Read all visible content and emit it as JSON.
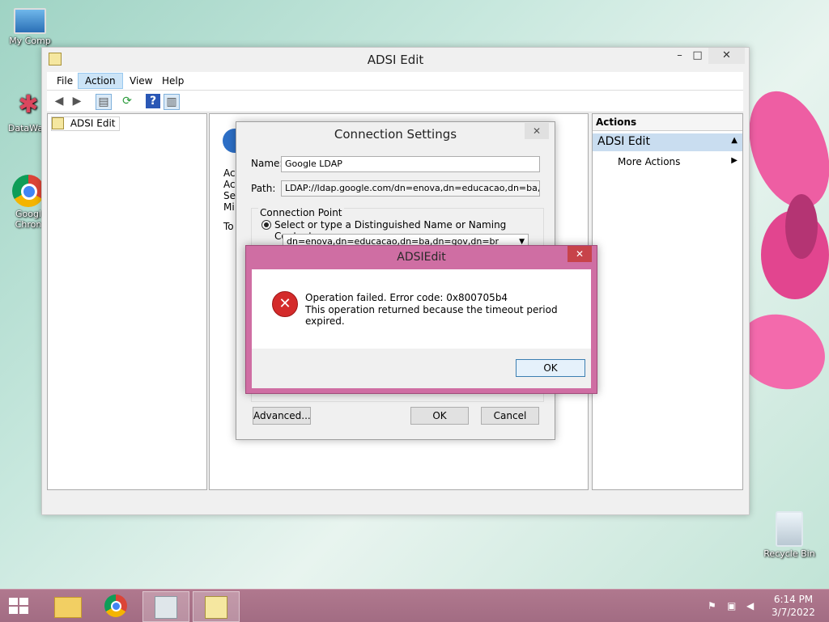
{
  "desktop": {
    "icons": [
      {
        "label": "My Comp"
      },
      {
        "label": "DataWag"
      },
      {
        "label": "Googl Chron"
      },
      {
        "label": "Recycle Bin"
      }
    ]
  },
  "main_window": {
    "title": "ADSI Edit",
    "controls": {
      "minimize": "–",
      "maximize": "□",
      "close": "✕"
    },
    "menu": [
      "File",
      "Action",
      "View",
      "Help"
    ],
    "active_menu": "Action",
    "tree": {
      "root": "ADSI Edit"
    },
    "middle_pane_fragments": [
      "Act",
      "Act",
      "Ser",
      "Mi",
      "To"
    ],
    "actions_pane": {
      "header": "Actions",
      "section": "ADSI Edit",
      "item": "More Actions"
    }
  },
  "connection_settings": {
    "title": "Connection Settings",
    "close": "✕",
    "name_label": "Name:",
    "name_value": "Google LDAP",
    "path_label": "Path:",
    "path_value": "LDAP://ldap.google.com/dn=enova,dn=educacao,dn=ba,dn=go",
    "group_label": "Connection Point",
    "radio_label": "Select or type a Distinguished Name or Naming Context:",
    "dn_value": "dn=enova,dn=educacao,dn=ba,dn=gov,dn=br",
    "advanced": "Advanced...",
    "ok": "OK",
    "cancel": "Cancel"
  },
  "error_dialog": {
    "title": "ADSIEdit",
    "close": "✕",
    "line1": "Operation failed. Error code: 0x800705b4",
    "line2": "This operation returned because the timeout period expired.",
    "ok": "OK"
  },
  "taskbar": {
    "time": "6:14 PM",
    "date": "3/7/2022"
  },
  "colors": {
    "accent_pink": "#c2588f",
    "selection_blue": "#cce4f7",
    "error_red": "#d42b2b"
  }
}
